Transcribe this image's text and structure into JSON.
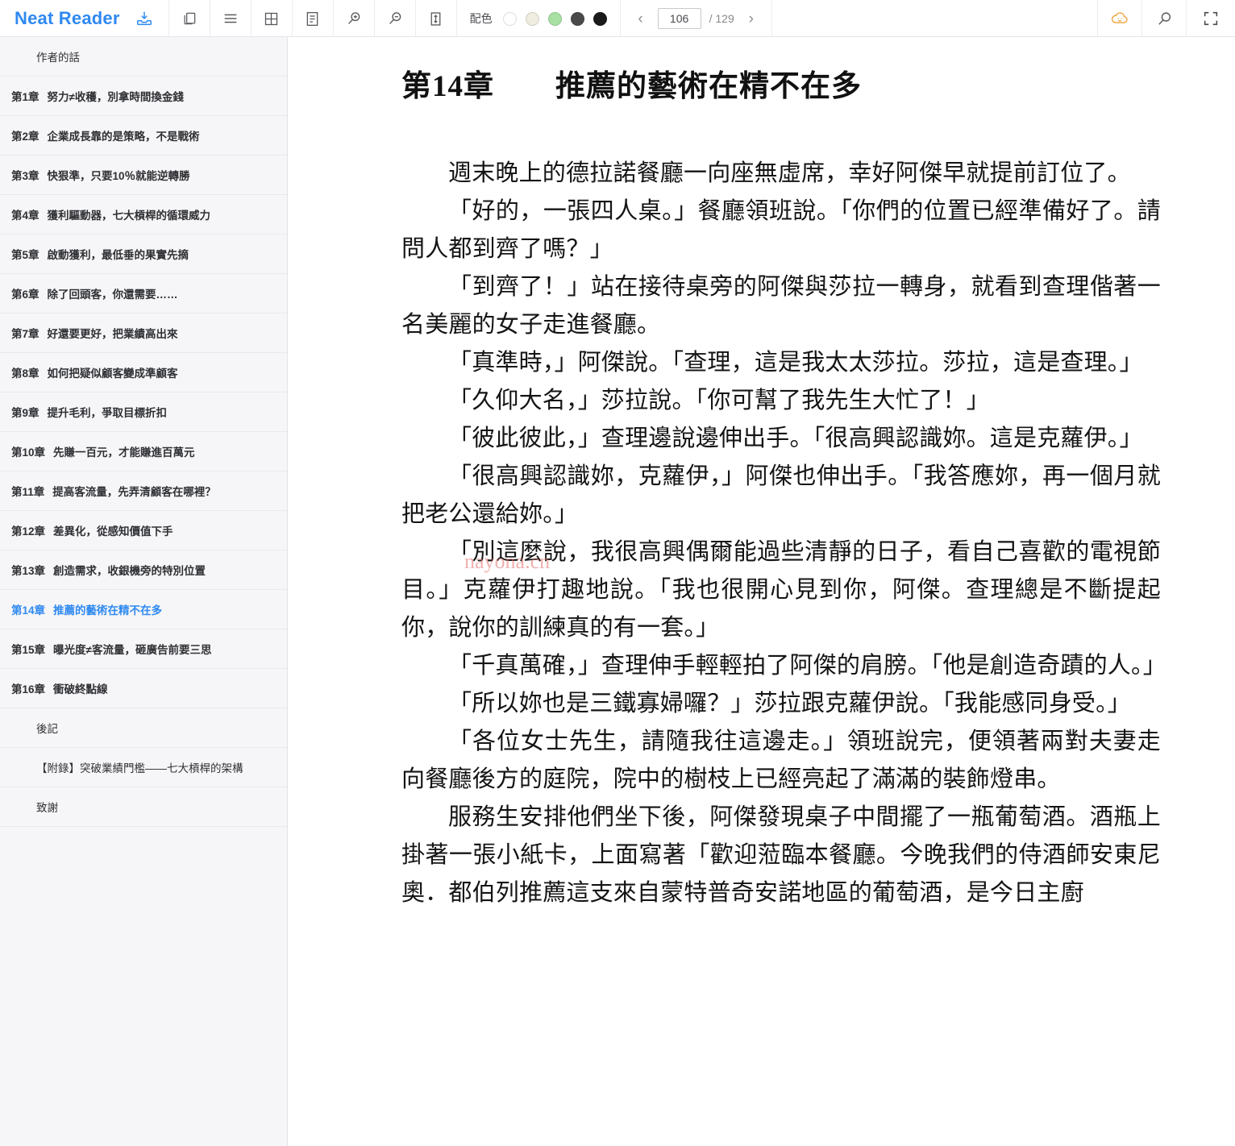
{
  "app": {
    "brand": "Neat Reader",
    "brand_color": "#2f89f0"
  },
  "toolbar": {
    "save_icon": "save-to-library-icon",
    "buttons": [
      {
        "name": "copy-icon",
        "title": "複製"
      },
      {
        "name": "menu-icon",
        "title": "目錄"
      },
      {
        "name": "grid-icon",
        "title": "分欄"
      },
      {
        "name": "note-icon",
        "title": "筆記"
      },
      {
        "name": "zoom-in-icon",
        "title": "放大"
      },
      {
        "name": "zoom-out-icon",
        "title": "縮小"
      },
      {
        "name": "line-height-icon",
        "title": "行距"
      }
    ],
    "scheme": {
      "label": "配色",
      "swatches": [
        {
          "name": "scheme-white",
          "color": "#ffffff",
          "selected": true
        },
        {
          "name": "scheme-cream",
          "color": "#efeddf",
          "selected": false
        },
        {
          "name": "scheme-green",
          "color": "#a8e0a4",
          "selected": false
        },
        {
          "name": "scheme-gray",
          "color": "#4a4a4a",
          "selected": false
        },
        {
          "name": "scheme-black",
          "color": "#1a1a1a",
          "selected": false
        }
      ]
    },
    "pager": {
      "prev": "‹",
      "next": "›",
      "current_page": "106",
      "total_label": "/ 129",
      "total_pages": "129"
    },
    "right_buttons": [
      {
        "name": "cloud-sync-icon",
        "title": "雲端同步",
        "color": "#f0a23c"
      },
      {
        "name": "search-icon",
        "title": "搜尋",
        "color": "#5a5a5e"
      },
      {
        "name": "fullscreen-icon",
        "title": "全螢幕",
        "color": "#5a5a5e"
      }
    ]
  },
  "sidebar": {
    "items": [
      {
        "level": 1,
        "num": "",
        "title": "作者的話",
        "active": false
      },
      {
        "level": 0,
        "num": "第1章",
        "title": "努力≠收穫，別拿時間換金錢",
        "active": false
      },
      {
        "level": 0,
        "num": "第2章",
        "title": "企業成長靠的是策略，不是戰術",
        "active": false
      },
      {
        "level": 0,
        "num": "第3章",
        "title": "快狠準，只要10％就能逆轉勝",
        "active": false
      },
      {
        "level": 0,
        "num": "第4章",
        "title": "獲利驅動器，七大槓桿的循環威力",
        "active": false
      },
      {
        "level": 0,
        "num": "第5章",
        "title": "啟動獲利，最低垂的果實先摘",
        "active": false
      },
      {
        "level": 0,
        "num": "第6章",
        "title": "除了回頭客，你還需要……",
        "active": false
      },
      {
        "level": 0,
        "num": "第7章",
        "title": "好還要更好，把業績高出來",
        "active": false
      },
      {
        "level": 0,
        "num": "第8章",
        "title": "如何把疑似顧客變成準顧客",
        "active": false
      },
      {
        "level": 0,
        "num": "第9章",
        "title": "提升毛利，爭取目標折扣",
        "active": false
      },
      {
        "level": 0,
        "num": "第10章",
        "title": "先賺一百元，才能賺進百萬元",
        "active": false
      },
      {
        "level": 0,
        "num": "第11章",
        "title": "提高客流量，先弄清顧客在哪裡？",
        "active": false
      },
      {
        "level": 0,
        "num": "第12章",
        "title": "差異化，從感知價值下手",
        "active": false
      },
      {
        "level": 0,
        "num": "第13章",
        "title": "創造需求，收銀機旁的特別位置",
        "active": false
      },
      {
        "level": 0,
        "num": "第14章",
        "title": "推薦的藝術在精不在多",
        "active": true
      },
      {
        "level": 0,
        "num": "第15章",
        "title": "曝光度≠客流量，砸廣告前要三思",
        "active": false
      },
      {
        "level": 0,
        "num": "第16章",
        "title": "衝破終點線",
        "active": false
      },
      {
        "level": 1,
        "num": "",
        "title": "後記",
        "active": false
      },
      {
        "level": 1,
        "num": "",
        "title": "【附錄】突破業績門檻——七大槓桿的架構",
        "active": false
      },
      {
        "level": 1,
        "num": "",
        "title": "致謝",
        "active": false
      }
    ]
  },
  "reader": {
    "chapter_title": "第14章　　推薦的藝術在精不在多",
    "watermark": "nayona.cn",
    "paragraphs": [
      "週末晚上的德拉諾餐廳一向座無虛席，幸好阿傑早就提前訂位了。",
      "「好的，一張四人桌。」餐廳領班說。「你們的位置已經準備好了。請問人都到齊了嗎？」",
      "「到齊了！」站在接待桌旁的阿傑與莎拉一轉身，就看到查理偕著一名美麗的女子走進餐廳。",
      "「真準時，」阿傑說。「查理，這是我太太莎拉。莎拉，這是查理。」",
      "「久仰大名，」莎拉說。「你可幫了我先生大忙了！」",
      "「彼此彼此，」查理邊說邊伸出手。「很高興認識妳。這是克蘿伊。」",
      "「很高興認識妳，克蘿伊，」阿傑也伸出手。「我答應妳，再一個月就把老公還給妳。」",
      "「別這麼說，我很高興偶爾能過些清靜的日子，看自己喜歡的電視節目。」克蘿伊打趣地說。「我也很開心見到你，阿傑。查理總是不斷提起你，說你的訓練真的有一套。」",
      "「千真萬確，」查理伸手輕輕拍了阿傑的肩膀。「他是創造奇蹟的人。」",
      "「所以妳也是三鐵寡婦囉？」莎拉跟克蘿伊說。「我能感同身受。」",
      "「各位女士先生，請隨我往這邊走。」領班說完，便領著兩對夫妻走向餐廳後方的庭院，院中的樹枝上已經亮起了滿滿的裝飾燈串。",
      "服務生安排他們坐下後，阿傑發現桌子中間擺了一瓶葡萄酒。酒瓶上掛著一張小紙卡，上面寫著「歡迎蒞臨本餐廳。今晚我們的侍酒師安東尼奧．都伯列推薦這支來自蒙特普奇安諾地區的葡萄酒，是今日主廚"
    ]
  }
}
